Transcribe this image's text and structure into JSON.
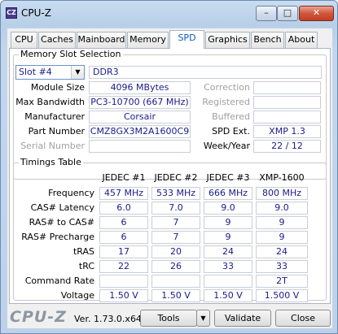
{
  "window": {
    "title": "CPU-Z",
    "icon_text": "CZ",
    "buttons": {
      "minimize": "–",
      "maximize": "□",
      "close": "✕"
    }
  },
  "tabs": [
    {
      "label": "CPU"
    },
    {
      "label": "Caches"
    },
    {
      "label": "Mainboard"
    },
    {
      "label": "Memory"
    },
    {
      "label": "SPD"
    },
    {
      "label": "Graphics"
    },
    {
      "label": "Bench"
    },
    {
      "label": "About"
    }
  ],
  "active_tab": "SPD",
  "slot_selection": {
    "title": "Memory Slot Selection",
    "slot_value": "Slot #4",
    "memory_type": "DDR3",
    "left_rows": [
      {
        "label": "Module Size",
        "value": "4096 MBytes"
      },
      {
        "label": "Max Bandwidth",
        "value": "PC3-10700 (667 MHz)"
      },
      {
        "label": "Manufacturer",
        "value": "Corsair"
      },
      {
        "label": "Part Number",
        "value": "CMZ8GX3M2A1600C9"
      },
      {
        "label": "Serial Number",
        "value": ""
      }
    ],
    "right_rows": [
      {
        "label": "Correction",
        "value": ""
      },
      {
        "label": "Registered",
        "value": ""
      },
      {
        "label": "Buffered",
        "value": ""
      },
      {
        "label": "SPD Ext.",
        "value": "XMP 1.3"
      },
      {
        "label": "Week/Year",
        "value": "22 / 12"
      }
    ]
  },
  "timings": {
    "title": "Timings Table",
    "columns": [
      "JEDEC #1",
      "JEDEC #2",
      "JEDEC #3",
      "XMP-1600"
    ],
    "rows": [
      {
        "label": "Frequency",
        "values": [
          "457 MHz",
          "533 MHz",
          "666 MHz",
          "800 MHz"
        ]
      },
      {
        "label": "CAS# Latency",
        "values": [
          "6.0",
          "7.0",
          "9.0",
          "9.0"
        ]
      },
      {
        "label": "RAS# to CAS#",
        "values": [
          "6",
          "7",
          "9",
          "9"
        ]
      },
      {
        "label": "RAS# Precharge",
        "values": [
          "6",
          "7",
          "9",
          "9"
        ]
      },
      {
        "label": "tRAS",
        "values": [
          "17",
          "20",
          "24",
          "24"
        ]
      },
      {
        "label": "tRC",
        "values": [
          "22",
          "26",
          "33",
          "33"
        ]
      },
      {
        "label": "Command Rate",
        "values": [
          "",
          "",
          "",
          "2T"
        ]
      },
      {
        "label": "Voltage",
        "values": [
          "1.50 V",
          "1.50 V",
          "1.50 V",
          "1.500 V"
        ]
      }
    ]
  },
  "footer": {
    "brand": "CPU-Z",
    "version": "Ver. 1.73.0.x64",
    "tools_label": "Tools",
    "tools_arrow": "▼",
    "validate_label": "Validate",
    "close_label": "Close"
  }
}
